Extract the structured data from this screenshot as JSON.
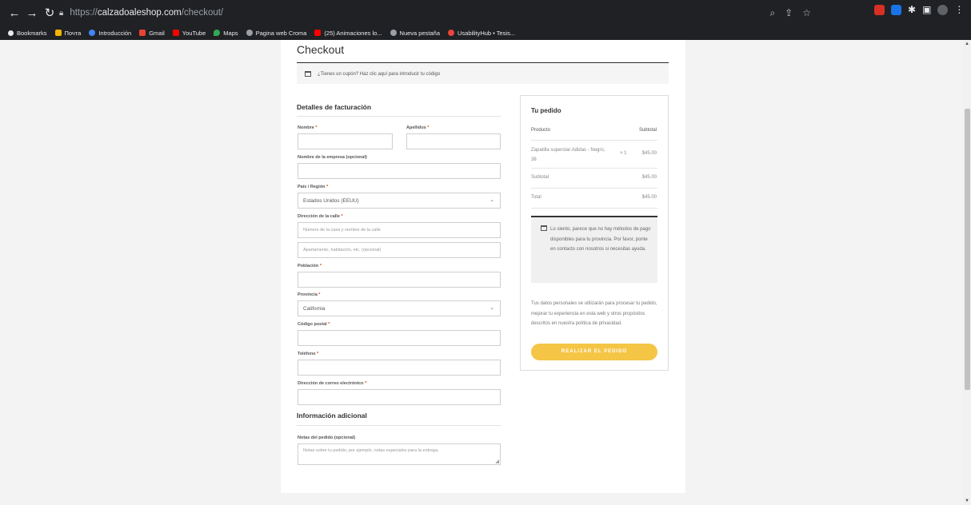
{
  "browser": {
    "url_prefix": "https://",
    "url_domain": "calzadoaleshop.com",
    "url_path": "/checkout/",
    "bookmarks": [
      {
        "label": "Bookmarks",
        "color": "#e8eaed"
      },
      {
        "label": "Почта",
        "color": "#f4b400"
      },
      {
        "label": "Introducción",
        "color": "#4285f4"
      },
      {
        "label": "Gmail",
        "color": "#ea4335"
      },
      {
        "label": "YouTube",
        "color": "#ff0000"
      },
      {
        "label": "Maps",
        "color": "#34a853"
      },
      {
        "label": "Pagina web Croma",
        "color": "#9aa0a6"
      },
      {
        "label": "(25) Animaciones lo...",
        "color": "#ff0000"
      },
      {
        "label": "Nueva pestaña",
        "color": "#9aa0a6"
      },
      {
        "label": "UsabilityHub • Tesis...",
        "color": "#e8453c"
      }
    ]
  },
  "page": {
    "title": "Checkout",
    "coupon_text": "¿Tienes un cupón? Haz clic aquí para introducir tu código"
  },
  "billing": {
    "heading": "Detalles de facturación",
    "first_name_label": "Nombre",
    "last_name_label": "Apellidos",
    "company_label": "Nombre de la empresa (opcional)",
    "country_label": "País / Región",
    "country_value": "Estados Unidos (EEUU)",
    "street_label": "Dirección de la calle",
    "street_placeholder": "Número de la casa y nombre de la calle",
    "street2_placeholder": "Apartamento, habitación, etc. (opcional)",
    "city_label": "Población",
    "state_label": "Provincia",
    "state_value": "California",
    "zip_label": "Código postal",
    "phone_label": "Teléfono",
    "email_label": "Dirección de correo electrónico",
    "required_mark": "*"
  },
  "additional": {
    "heading": "Información adicional",
    "notes_label": "Notas del pedido (opcional)",
    "notes_placeholder": "Notas sobre tu pedido, por ejemplo, notas especiales para la entrega."
  },
  "order": {
    "heading": "Tu pedido",
    "col_product": "Producto",
    "col_subtotal": "Subtotal",
    "item_name": "Zapatilla superstar Adidas - Negro, 38",
    "item_qty": "× 1",
    "item_price": "$45.00",
    "subtotal_label": "Subtotal",
    "subtotal_value": "$45.00",
    "total_label": "Total",
    "total_value": "$45.00",
    "notice": "Lo siento, parece que no hay métodos de pago disponibles para tu provincia. Por favor, ponte en contacto con nosotros si necesitas ayuda.",
    "privacy": "Tus datos personales se utilizarán para procesar tu pedido, mejorar tu experiencia en esta web y otros propósitos descritos en nuestra política de privacidad.",
    "place_order": "REALIZAR EL PEDIDO"
  }
}
